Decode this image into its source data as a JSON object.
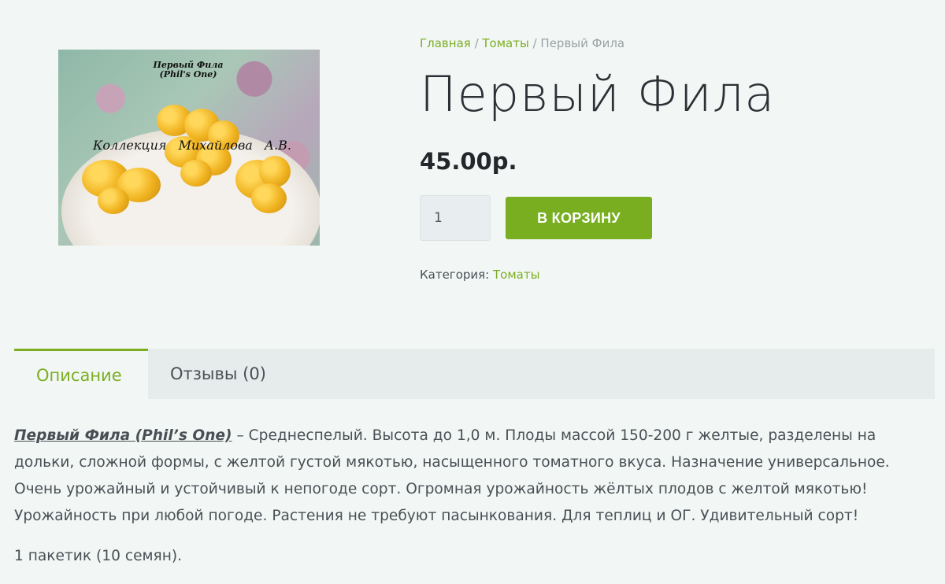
{
  "image": {
    "caption_title": "Первый Фила\n(Phil's One)",
    "caption_collection": "Коллекция Михайлова А.В."
  },
  "breadcrumb": {
    "home": "Главная",
    "separator": " / ",
    "category": "Томаты",
    "current": "Первый Фила"
  },
  "product": {
    "title": "Первый Фила",
    "price": "45.00р.",
    "quantity": "1",
    "add_to_cart_label": "В КОРЗИНУ",
    "category_label": "Категория:",
    "category_value": "Томаты"
  },
  "tabs": [
    {
      "label": "Описание",
      "active": true
    },
    {
      "label": "Отзывы (0)",
      "active": false
    }
  ],
  "description": {
    "variety_link": "Первый Фила (Phil’s One)",
    "text": " – Среднеспелый. Высота до 1,0 м. Плоды массой 150-200 г желтые, разделены на дольки, сложной формы, с желтой густой мякотью, насыщенного томатного вкуса. Назначение универсальное. Очень урожайный и устойчивый к непогоде сорт. Огромная урожайность жёлтых плодов с желтой мякотью! Урожайность при любой погоде. Растения не требуют пасынкования. Для теплиц и ОГ. Удивительный сорт!",
    "packet": "1 пакетик (10 семян)."
  },
  "colors": {
    "accent": "#7cae22",
    "button": "#78ae20",
    "background": "#f2f7f5",
    "tab_bar": "#e6eceb"
  }
}
